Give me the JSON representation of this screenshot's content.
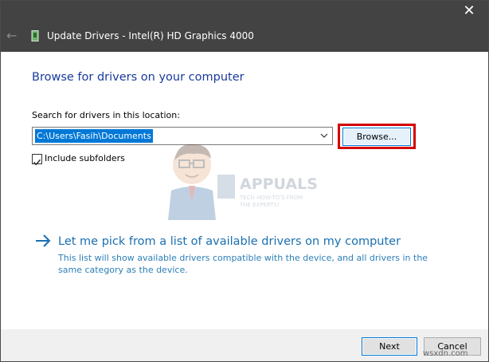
{
  "window": {
    "title": "Update Drivers - Intel(R) HD Graphics 4000",
    "close_glyph": "✕",
    "back_glyph": "←"
  },
  "heading": "Browse for drivers on your computer",
  "search": {
    "label": "Search for drivers in this location:",
    "path_value": "C:\\Users\\Fasih\\Documents",
    "browse_label": "Browse..."
  },
  "subfolders": {
    "label": "Include subfolders",
    "checked": true
  },
  "watermark": {
    "brand": "APPUALS",
    "tagline_1": "TECH HOW-TO'S FROM",
    "tagline_2": "THE EXPERTS!"
  },
  "pick": {
    "link": "Let me pick from a list of available drivers on my computer",
    "description": "This list will show available drivers compatible with the device, and all drivers in the same category as the device."
  },
  "footer": {
    "next_label": "Next",
    "cancel_label": "Cancel"
  },
  "site_watermark": "wsxdn.com",
  "colors": {
    "titlebar": "#434343",
    "heading": "#1a3a9e",
    "link": "#1a6fb0",
    "selection": "#0078d7",
    "highlight": "#d40000"
  },
  "icons": {
    "back": "back-arrow-icon",
    "device": "device-icon",
    "close": "close-icon",
    "dropdown": "chevron-down-icon",
    "check": "checkmark-icon",
    "pick": "right-arrow-icon"
  }
}
